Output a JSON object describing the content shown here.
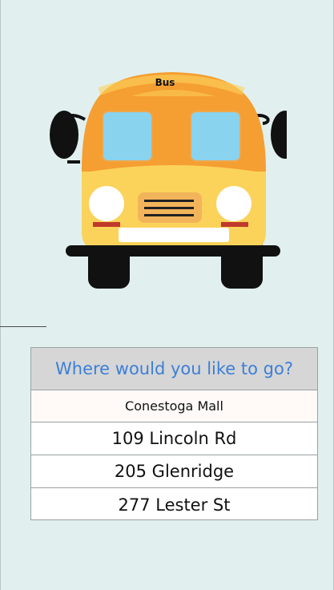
{
  "bus": {
    "label": "Bus"
  },
  "destination_picker": {
    "prompt": "Where would you like to go?",
    "options": [
      "Conestoga Mall",
      "109 Lincoln Rd",
      "205 Glenridge",
      "277 Lester St"
    ]
  },
  "colors": {
    "background": "#e1f0ef",
    "bus_roof": "#f59e32",
    "bus_body": "#fbd35b",
    "windows": "#8ad3ef",
    "prompt_text": "#3b7fd9"
  }
}
